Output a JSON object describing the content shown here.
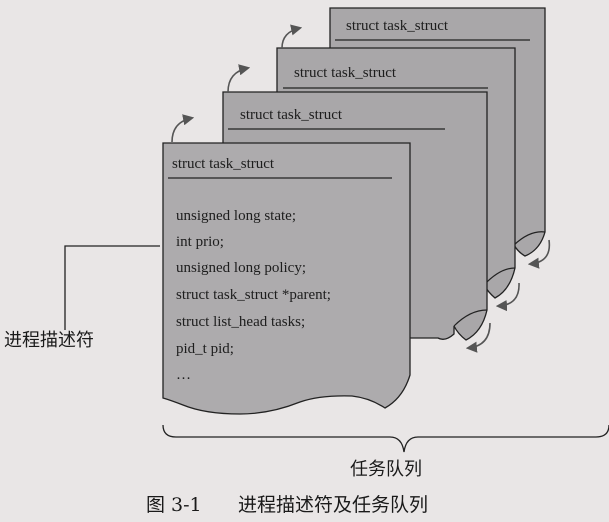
{
  "cards": [
    {
      "title": "struct task_struct"
    },
    {
      "title": "struct task_struct"
    },
    {
      "title": "struct task_struct"
    },
    {
      "title": "struct task_struct"
    }
  ],
  "fields": [
    "unsigned long state;",
    "int prio;",
    "unsigned long policy;",
    "struct task_struct *parent;",
    "struct list_head tasks;",
    "pid_t pid;",
    "…"
  ],
  "labels": {
    "descriptor": "进程描述符",
    "queue": "任务队列"
  },
  "caption": {
    "figure_no": "图 3-1",
    "text": "进程描述符及任务队列"
  }
}
